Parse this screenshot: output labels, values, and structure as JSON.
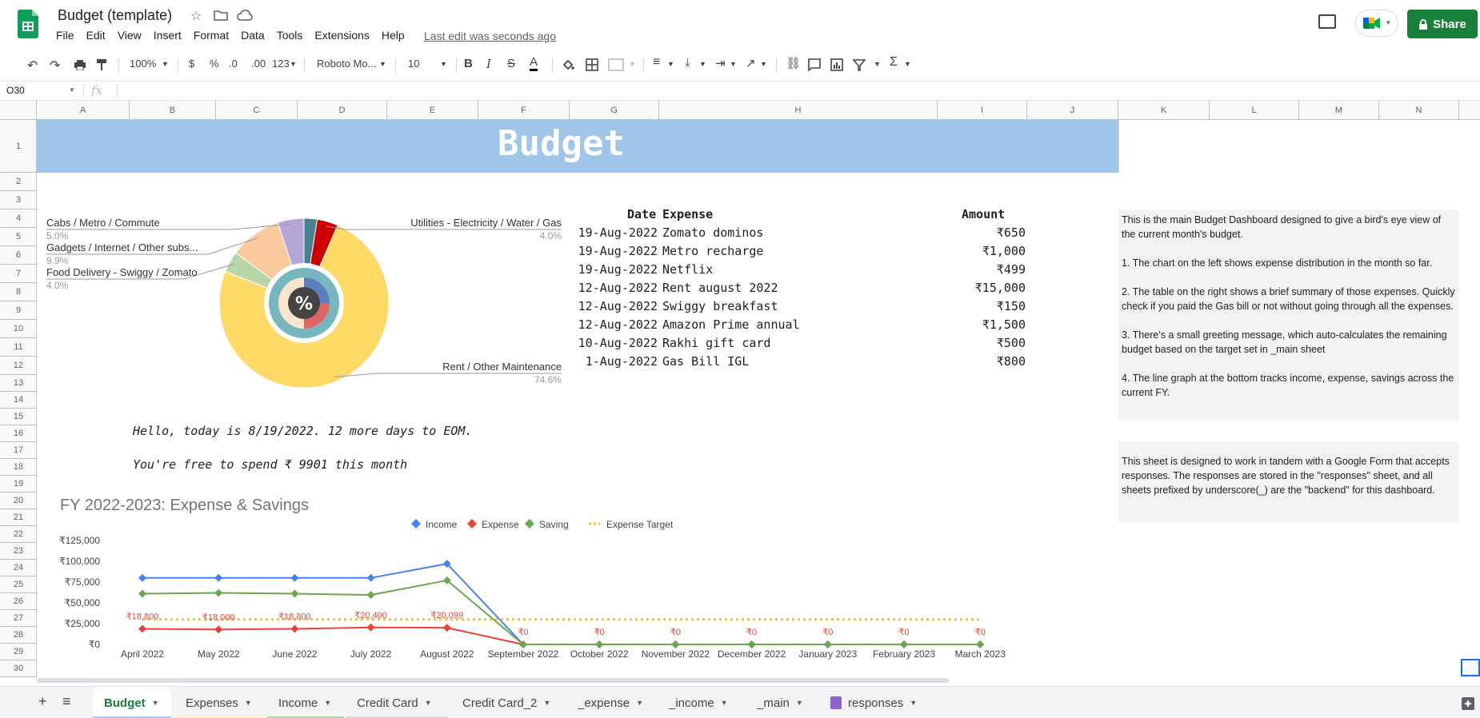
{
  "app": {
    "doc_title": "Budget (template)",
    "menu": [
      "File",
      "Edit",
      "View",
      "Insert",
      "Format",
      "Data",
      "Tools",
      "Extensions",
      "Help"
    ],
    "last_edit": "Last edit was seconds ago",
    "share_label": "Share"
  },
  "toolbar": {
    "zoom": "100%",
    "currency": "$",
    "percent": "%",
    "dec_less": ".0",
    "dec_more": ".00",
    "format_num": "123",
    "font": "Roboto Mo...",
    "font_size": "10",
    "bold": "B",
    "italic": "I",
    "strike": "S",
    "text_color": "A",
    "sigma": "Σ"
  },
  "formula_bar": {
    "name_box": "O30",
    "fx": "fx"
  },
  "columns": [
    "A",
    "B",
    "C",
    "D",
    "E",
    "F",
    "G",
    "H",
    "I",
    "J",
    "K",
    "L",
    "M",
    "N"
  ],
  "rows": [
    "1",
    "2",
    "3",
    "4",
    "5",
    "6",
    "7",
    "8",
    "9",
    "10",
    "11",
    "12",
    "13",
    "14",
    "15",
    "16",
    "17",
    "18",
    "19",
    "20",
    "21",
    "22",
    "23",
    "24",
    "25",
    "26",
    "27",
    "28",
    "29",
    "30"
  ],
  "sheet": {
    "banner_title": "Budget",
    "table": {
      "headers": {
        "date": "Date",
        "expense": "Expense",
        "amount": "Amount"
      },
      "rows": [
        {
          "date": "19-Aug-2022",
          "expense": "Zomato dominos",
          "amount": "₹650"
        },
        {
          "date": "19-Aug-2022",
          "expense": "Metro recharge",
          "amount": "₹1,000"
        },
        {
          "date": "19-Aug-2022",
          "expense": "Netflix",
          "amount": "₹499"
        },
        {
          "date": "12-Aug-2022",
          "expense": "Rent august 2022",
          "amount": "₹15,000"
        },
        {
          "date": "12-Aug-2022",
          "expense": "Swiggy breakfast",
          "amount": "₹150"
        },
        {
          "date": "12-Aug-2022",
          "expense": "Amazon Prime annual",
          "amount": "₹1,500"
        },
        {
          "date": "10-Aug-2022",
          "expense": "Rakhi gift card",
          "amount": "₹500"
        },
        {
          "date": "1-Aug-2022",
          "expense": "Gas Bill IGL",
          "amount": "₹800"
        }
      ]
    },
    "greeting_1": "Hello, today is 8/19/2022. 12 more days to EOM.",
    "greeting_2": "You're free to spend ₹ 9901 this month",
    "note_1": "This is the main Budget Dashboard designed to give a bird's eye view of the current month's budget.\n\n1. The chart on the left shows expense distribution in the month so far.\n\n2. The table on the right shows a brief summary of those expenses. Quickly check if you paid the Gas bill or not without going through all the expenses.\n\n3. There's a small greeting message, which auto-calculates the remaining budget based on the target set in _main sheet\n\n4. The line graph at the bottom tracks income, expense, savings across the current FY.",
    "note_2": "This sheet is designed to work in tandem with a Google Form that accepts responses. The responses are stored in the \"responses\" sheet, and all sheets prefixed by underscore(_) are the \"backend\" for this dashboard."
  },
  "chart_data": [
    {
      "type": "pie",
      "categories": [
        "Rent / Other Maintenance",
        "Utilities - Electricity / Water / Gas",
        "Cabs / Metro / Commute",
        "Gadgets / Internet / Other subs...",
        "Food Delivery - Swiggy / Zomato"
      ],
      "values": [
        74.6,
        4.0,
        5.0,
        9.9,
        4.0
      ],
      "labels": [
        "74.6%",
        "4.0%",
        "5.0%",
        "9.9%",
        "4.0%"
      ],
      "colors": [
        "#ffd966",
        "#cc0000",
        "#b4a7d6",
        "#f9cb9c",
        "#b6d7a8"
      ],
      "other_slice_color": "#45818e"
    },
    {
      "type": "line",
      "title": "FY 2022-2023: Expense & Savings",
      "categories": [
        "April 2022",
        "May 2022",
        "June 2022",
        "July 2022",
        "August 2022",
        "September 2022",
        "October 2022",
        "November 2022",
        "December 2022",
        "January 2023",
        "February 2023",
        "March 2023"
      ],
      "ylim": [
        0,
        125000
      ],
      "yticks": [
        "₹0",
        "₹25,000",
        "₹50,000",
        "₹75,000",
        "₹100,000",
        "₹125,000"
      ],
      "ytick_values": [
        0,
        25000,
        50000,
        75000,
        100000,
        125000
      ],
      "legend_position": "top",
      "series": [
        {
          "name": "Income",
          "color": "#4285f4",
          "values": [
            80000,
            80000,
            80000,
            80000,
            97000,
            0,
            0,
            0,
            0,
            0,
            0,
            0
          ]
        },
        {
          "name": "Expense",
          "color": "#ea4335",
          "values": [
            18800,
            18000,
            18800,
            20400,
            20099,
            0,
            0,
            0,
            0,
            0,
            0,
            0
          ]
        },
        {
          "name": "Saving",
          "color": "#6aa84f",
          "values": [
            61000,
            62000,
            61000,
            59500,
            77000,
            0,
            0,
            0,
            0,
            0,
            0,
            0
          ]
        },
        {
          "name": "Expense Target",
          "color": "#f1c232",
          "dashed": true,
          "values": [
            30000,
            30000,
            30000,
            30000,
            30000,
            30000,
            30000,
            30000,
            30000,
            30000,
            30000,
            30000
          ]
        }
      ],
      "data_labels": [
        "₹18,800",
        "₹18,000",
        "₹18,800",
        "₹20,400",
        "₹20,099",
        "₹0",
        "₹0",
        "₹0",
        "₹0",
        "₹0",
        "₹0",
        "₹0"
      ]
    }
  ],
  "tabs": [
    {
      "label": "Budget",
      "color": "#188038",
      "active": true
    },
    {
      "label": "Expenses",
      "color": "#fff2cc"
    },
    {
      "label": "Income",
      "color": "#b6d7a8"
    },
    {
      "label": "Credit Card",
      "color": "#d9d9d9"
    },
    {
      "label": "Credit Card_2",
      "color": ""
    },
    {
      "label": "_expense",
      "color": ""
    },
    {
      "label": "_income",
      "color": ""
    },
    {
      "label": "_main",
      "color": ""
    },
    {
      "label": "responses",
      "color": "",
      "icon": "form-icon"
    }
  ]
}
